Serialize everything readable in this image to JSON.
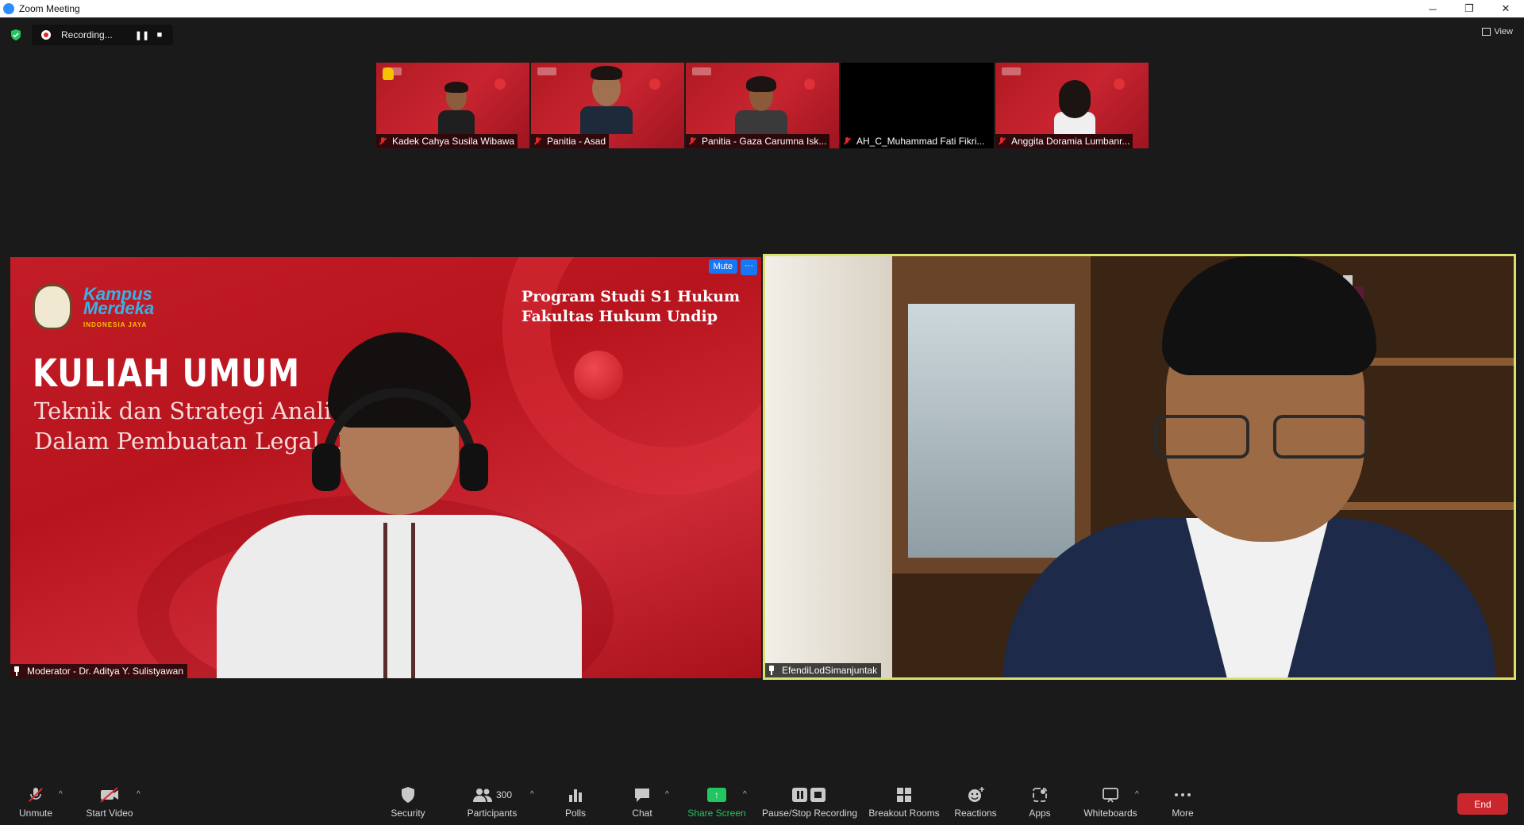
{
  "window": {
    "title": "Zoom Meeting",
    "minimize": "─",
    "restore": "❐",
    "close": "✕"
  },
  "topbar": {
    "recording_label": "Recording...",
    "pause": "❚❚",
    "stop": "■",
    "view_label": "View"
  },
  "thumbnails": [
    {
      "name": "Kadek Cahya Susila Wibawa",
      "raised_hand": true,
      "video": true
    },
    {
      "name": "Panitia - Asad",
      "raised_hand": false,
      "video": true
    },
    {
      "name": "Panitia - Gaza Carumna Isk...",
      "raised_hand": false,
      "video": true
    },
    {
      "name": "AH_C_Muhammad Fati Fikri...",
      "raised_hand": false,
      "video": false
    },
    {
      "name": "Anggita Doramia Lumbanr...",
      "raised_hand": false,
      "video": true
    }
  ],
  "slide": {
    "kuliah": "KULIAH UMUM",
    "teknik_line1": "Teknik dan Strategi Analisis",
    "teknik_line2": "Dalam Pembuatan Legal Opinion",
    "program_line1": "Program Studi S1 Hukum",
    "program_line2": "Fakultas Hukum Undip",
    "kampus": "Kampus",
    "merdeka": "Merdeka",
    "kampus_sub": "INDONESIA JAYA"
  },
  "main_tiles": {
    "left_name": "Moderator - Dr. Aditya Y. Sulistyawan",
    "right_name": "EfendiLodSimanjuntak",
    "mute_label": "Mute",
    "more_label": "···"
  },
  "toolbar": {
    "unmute": "Unmute",
    "start_video": "Start Video",
    "security": "Security",
    "participants": "Participants",
    "participants_count": "300",
    "polls": "Polls",
    "chat": "Chat",
    "share_screen": "Share Screen",
    "pause_stop_recording": "Pause/Stop Recording",
    "breakout_rooms": "Breakout Rooms",
    "reactions": "Reactions",
    "apps": "Apps",
    "whiteboards": "Whiteboards",
    "more": "More",
    "end": "End",
    "caret": "^"
  },
  "colors": {
    "accent_blue": "#1877f2",
    "share_green": "#22c55e",
    "end_red": "#c9272d",
    "active_speaker": "#d9e26b",
    "slide_red": "#c21d27"
  }
}
